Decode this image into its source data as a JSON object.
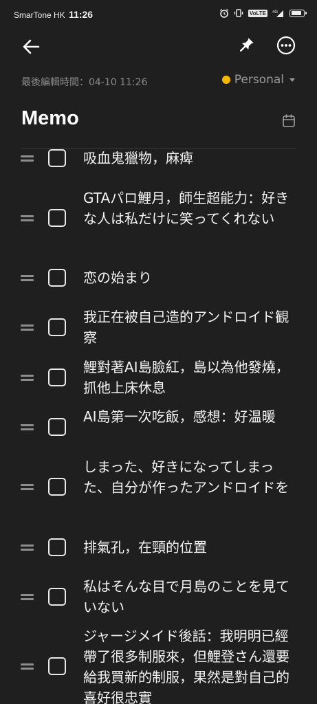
{
  "status_bar": {
    "carrier": "SmarTone HK",
    "time": "11:26",
    "network": "4G",
    "volte": "VoLTE",
    "battery_level": 0.9
  },
  "toolbar": {
    "back_icon": "arrow-left-icon",
    "pin_icon": "pin-icon",
    "more_icon": "more-horizontal-icon"
  },
  "meta": {
    "last_edited": "最後編輯時間：04-10 11:26",
    "category": "Personal",
    "category_color": "#f5b800"
  },
  "title": "Memo",
  "items": [
    {
      "text": "吸血鬼獵物，麻痺",
      "checked": false
    },
    {
      "text": "GTAパロ鯉月，師生超能力：好きな人は私だけに笑ってくれない",
      "checked": false
    },
    {
      "text": "恋の始まり",
      "checked": false
    },
    {
      "text": "我正在被自己造的アンドロイド観察",
      "checked": false
    },
    {
      "text": "鯉對著AI島臉紅，島以為他發燒，抓他上床休息",
      "checked": false
    },
    {
      "text": "AI島第一次吃飯，感想：好温暖",
      "checked": false
    },
    {
      "text": "しまった、好きになってしまった、自分が作ったアンドロイドを",
      "checked": false
    },
    {
      "text": "排氣孔，在頸的位置",
      "checked": false
    },
    {
      "text": "私はそんな目で月島のことを見ていない",
      "checked": false
    },
    {
      "text": "ジャージメイド後話：我明明已經帶了很多制服來，但鯉登さん還要給我買新的制服，果然是對自己的喜好很忠實",
      "checked": false
    }
  ]
}
